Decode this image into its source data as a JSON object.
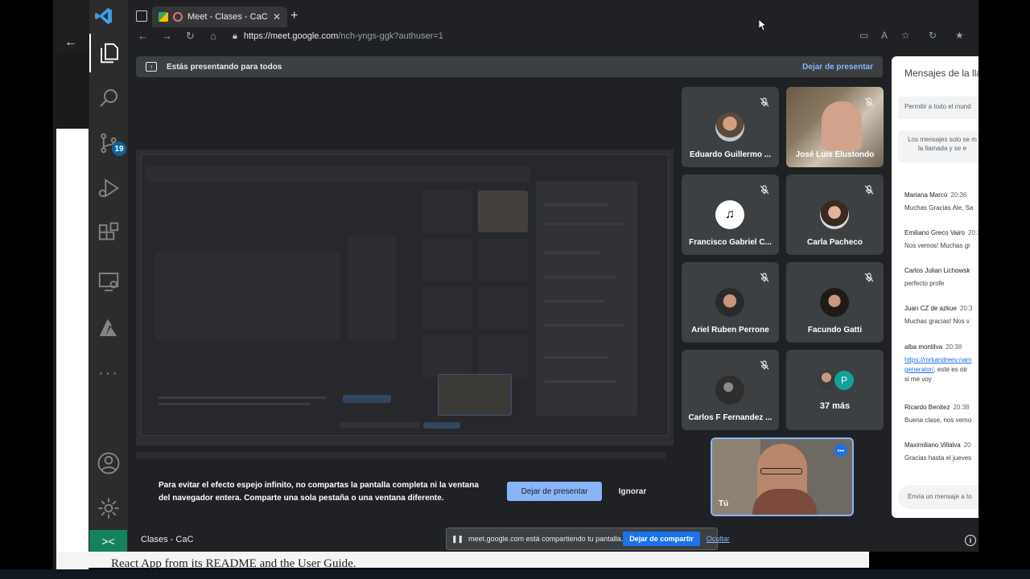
{
  "vscode": {
    "scm_badge": "19",
    "remote_glyph": "><",
    "status_meeting_name": "Clases - CaC"
  },
  "browser": {
    "tab_title": "Meet - Clases - CaC",
    "url_host": "https://meet.google.com",
    "url_path": "/nch-yngs-ggk?authuser=1"
  },
  "meet": {
    "presenting_text": "Estás presentando para todos",
    "stop_presenting_link": "Dejar de presentar",
    "participants": [
      {
        "name": "Eduardo Guillermo ...",
        "muted": true
      },
      {
        "name": "José Luis Elustondo",
        "muted": true
      },
      {
        "name": "Francisco Gabriel C...",
        "muted": true
      },
      {
        "name": "Carla Pacheco",
        "muted": true
      },
      {
        "name": "Ariel Ruben Perrone",
        "muted": true
      },
      {
        "name": "Facundo Gatti",
        "muted": true
      },
      {
        "name": "Carlos F Fernandez ...",
        "muted": true
      }
    ],
    "more_count": "37 más",
    "more_avatar_letter": "P",
    "self_label": "Tú",
    "mirror_warning": "Para evitar el efecto espejo infinito, no compartas la pantalla completa ni la ventana del navegador entera. Comparte una sola pestaña o una ventana diferente.",
    "btn_stop_presenting": "Dejar de presentar",
    "btn_ignore": "Ignorar",
    "meeting_name": "Clases - CaC",
    "share_notice": "meet.google.com está compartiendo tu pantalla.",
    "btn_stop_sharing": "Dejar de compartir",
    "btn_hide": "Ocultar"
  },
  "chat": {
    "title": "Mensajes de la lla",
    "allow_all": "Permitir a todo el mund",
    "notice_line1": "Los mensajes solo se m",
    "notice_line2": "la llamada y se e",
    "messages": [
      {
        "sender": "Mariana Marco",
        "time": "20:36",
        "text": "Muchas Gracias Ale, Sa"
      },
      {
        "sender": "Emiliano Greco Vairo",
        "time": "20:3",
        "text": "Nos vemos! Muchas gr"
      },
      {
        "sender": "Carlos Julian Lichowsk",
        "time": "",
        "text": "perfecto profe"
      },
      {
        "sender": "Juan CZ de azkue",
        "time": "20:3",
        "text": "Muchas gracias! Nos v"
      },
      {
        "sender": "alba montilva",
        "time": "20:38",
        "text_link": "https://mrkandreev.nam",
        "text_link2": "generator/",
        "text2": ", este es otr",
        "text3": "si me voy"
      },
      {
        "sender": "Ricardo Benitez",
        "time": "20:38",
        "text": "Buena clase, nos vemo"
      },
      {
        "sender": "Maximiliano Villalva",
        "time": "20",
        "text": "Gracias hasta el jueves"
      }
    ],
    "input_placeholder": "Envía un mensaje a to"
  },
  "background": {
    "bottom_text": "React App from its README and the User Guide."
  },
  "colors": {
    "meet_bg": "#202124",
    "tile_bg": "#3c4043",
    "accent_blue": "#8ab4f8",
    "vscode_remote_green": "#16825d",
    "vscode_badge": "#0e639c"
  },
  "icons": [
    "explorer-icon",
    "search-icon",
    "source-control-icon",
    "run-debug-icon",
    "extensions-icon",
    "remote-explorer-icon",
    "azure-icon",
    "more-icon",
    "account-icon",
    "settings-icon",
    "mic-off-icon",
    "info-icon",
    "present-icon",
    "lock-icon"
  ]
}
